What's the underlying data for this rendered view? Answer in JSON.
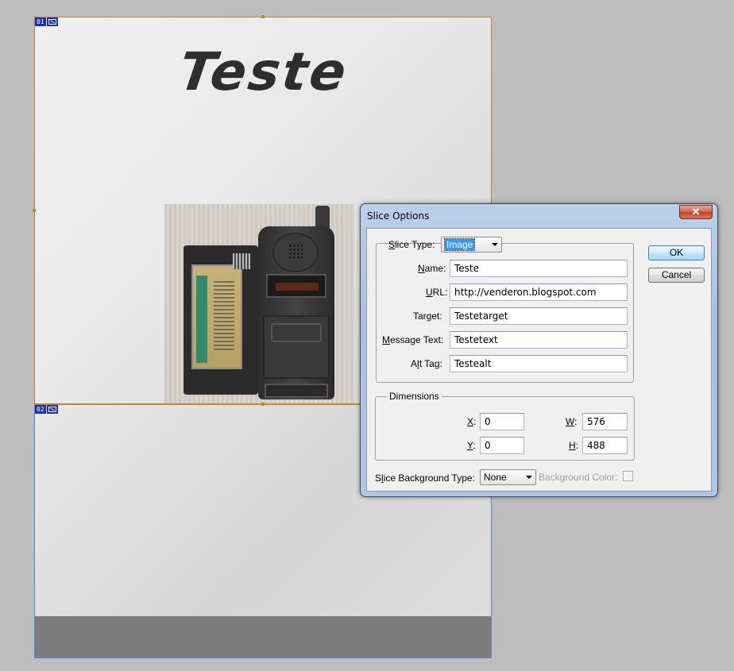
{
  "canvas": {
    "heading": "Teste",
    "slices": [
      {
        "number": "01"
      },
      {
        "number": "02"
      }
    ]
  },
  "dialog": {
    "title": "Slice Options",
    "close_glyph": "✕",
    "slice_type": {
      "label_key": "S",
      "label_rest": "lice Type:",
      "value": "Image"
    },
    "fields": {
      "name": {
        "label_key": "N",
        "label_rest": "ame:",
        "value": "Teste"
      },
      "url": {
        "label_key": "U",
        "label_rest": "RL:",
        "value": "http://venderon.blogspot.com"
      },
      "target": {
        "label_pre": "Tar",
        "label_key": "g",
        "label_rest": "et:",
        "value": "Testetarget"
      },
      "message": {
        "label_key": "M",
        "label_rest": "essage Text:",
        "value": "Testetext"
      },
      "alt": {
        "label_pre": "A",
        "label_key": "l",
        "label_rest": "t Tag:",
        "value": "Testealt"
      }
    },
    "dimensions": {
      "legend": "Dimensions",
      "x": {
        "label_key": "X",
        "label_rest": ":",
        "value": "0"
      },
      "y": {
        "label_key": "Y",
        "label_rest": ":",
        "value": "0"
      },
      "w": {
        "label_key": "W",
        "label_rest": ":",
        "value": "576"
      },
      "h": {
        "label_key": "H",
        "label_rest": ":",
        "value": "488"
      }
    },
    "background": {
      "label_pre": "S",
      "label_key": "l",
      "label_rest": "ice Background Type:",
      "value": "None",
      "color_label": "Background Color:"
    },
    "ok_label": "OK",
    "cancel_label": "Cancel"
  },
  "colors": {
    "slice_border": "#b88a2a",
    "slice_badge": "#1c2fb8",
    "selection": "#3399ff"
  }
}
